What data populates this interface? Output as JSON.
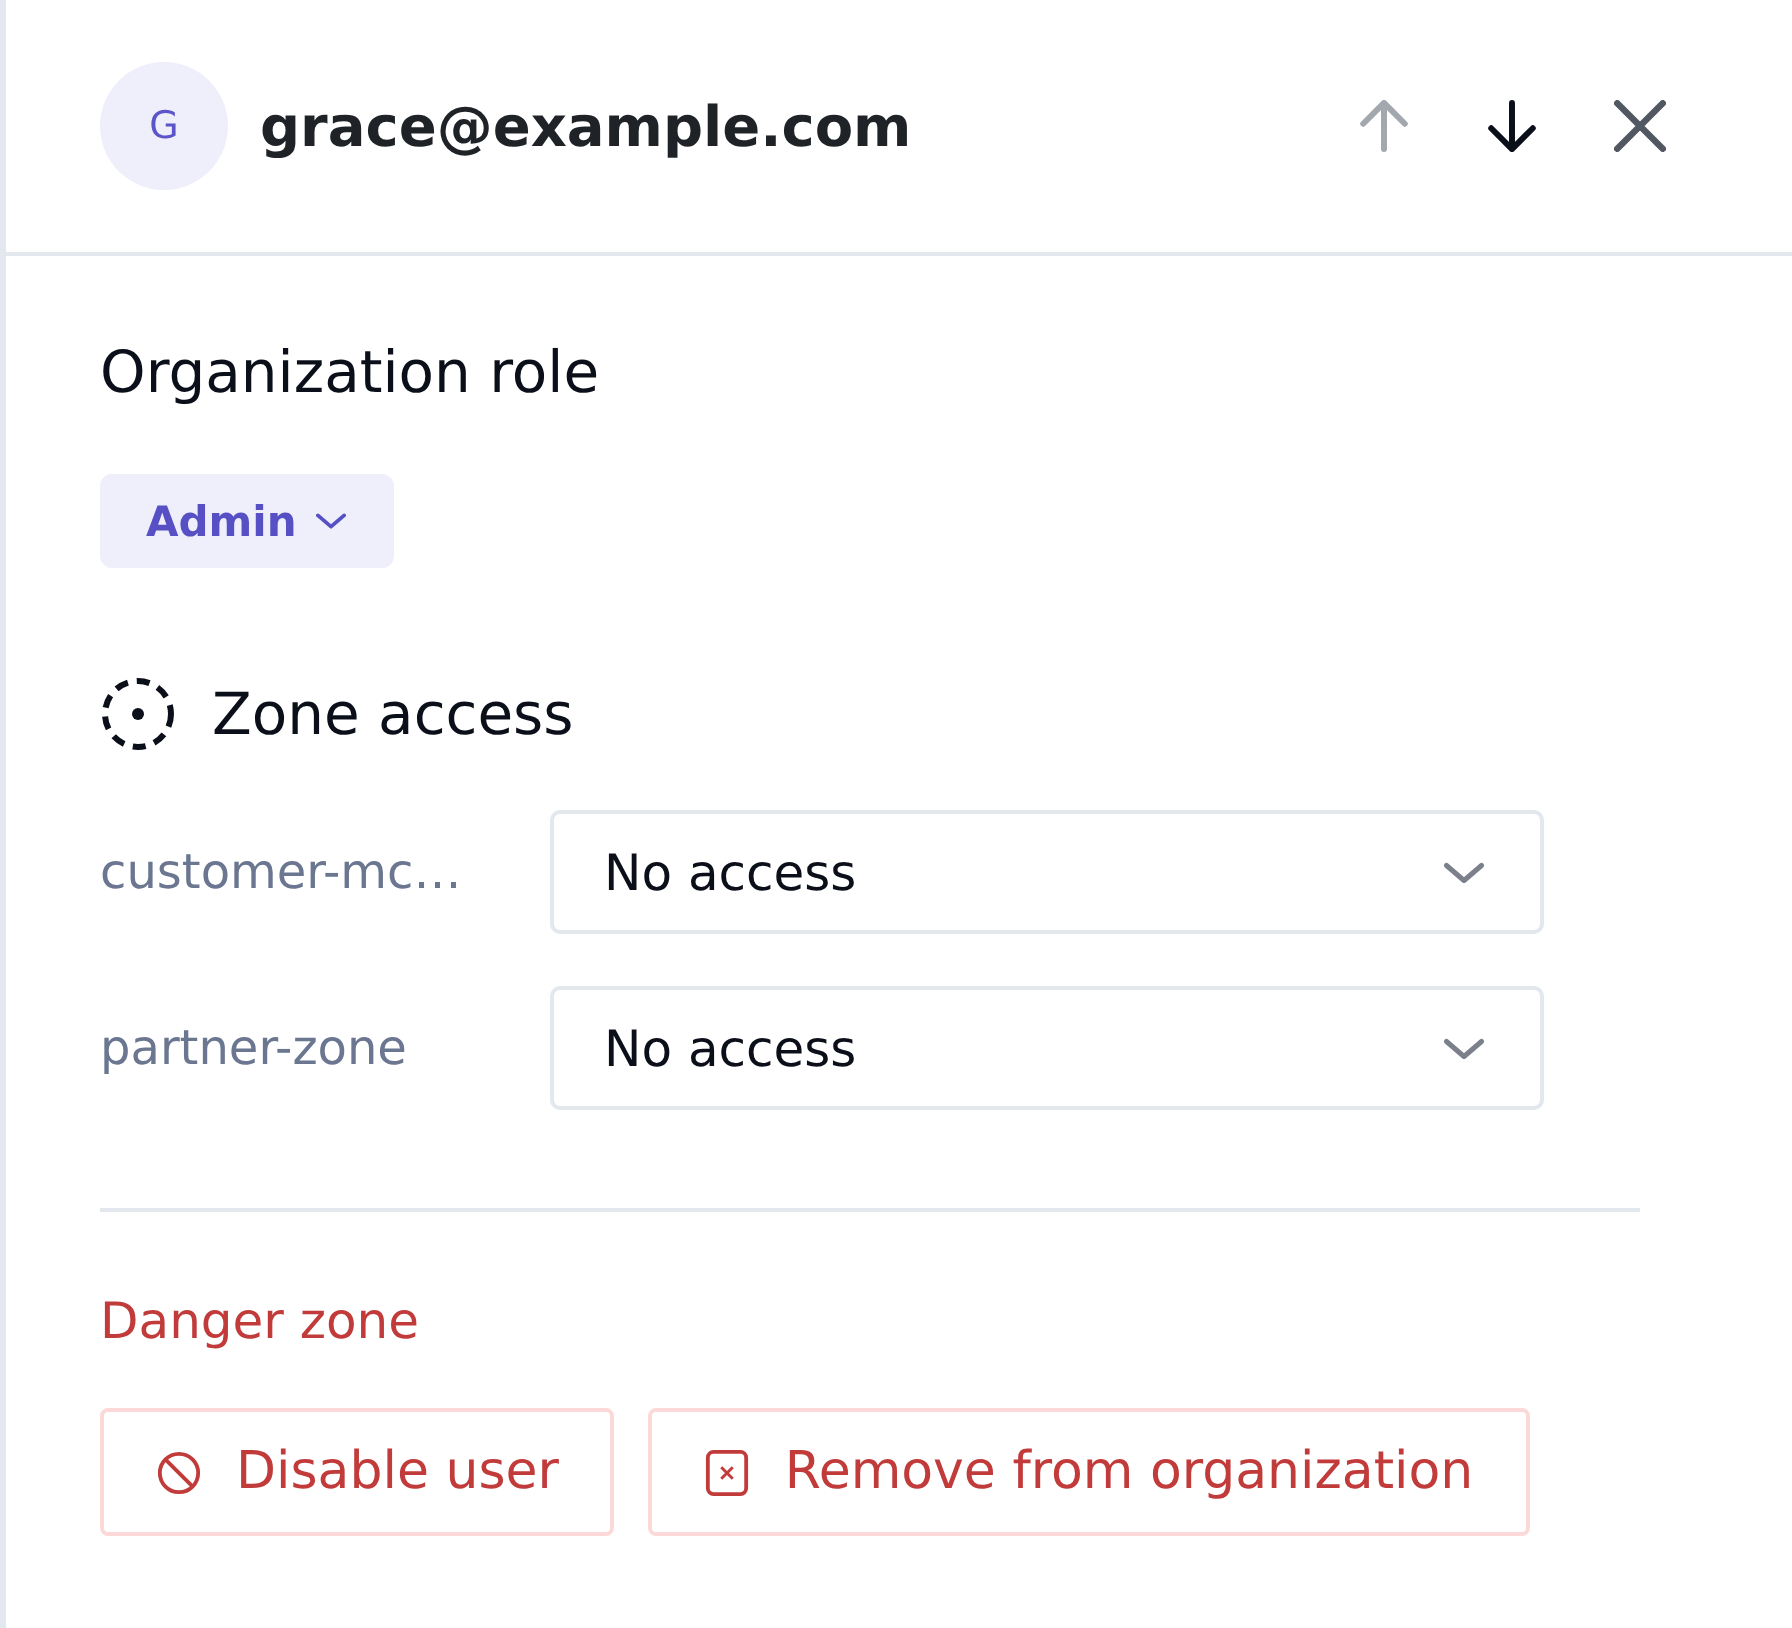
{
  "header": {
    "avatar_initial": "G",
    "email": "grace@example.com",
    "previous": {
      "disabled": true
    },
    "next": {
      "disabled": false
    }
  },
  "organization_role": {
    "title": "Organization role",
    "role": "Admin"
  },
  "zone_access": {
    "title": "Zone access",
    "zones": [
      {
        "name": "customer-mc…",
        "access": "No access"
      },
      {
        "name": "partner-zone",
        "access": "No access"
      }
    ]
  },
  "danger_zone": {
    "title": "Danger zone",
    "actions": [
      {
        "kind": "disable",
        "label": "Disable user"
      },
      {
        "kind": "remove",
        "label": "Remove from organization"
      }
    ]
  }
}
